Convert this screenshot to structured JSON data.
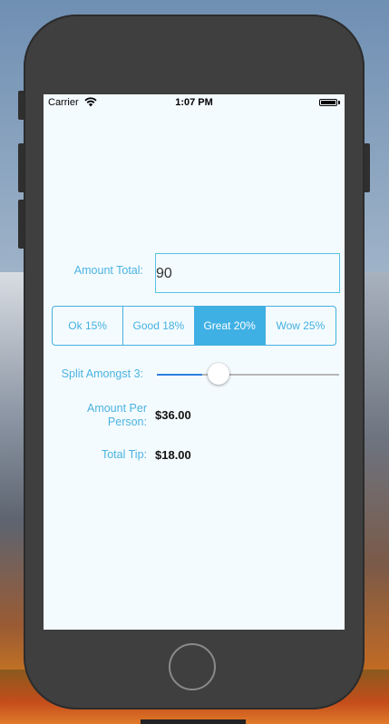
{
  "status_bar": {
    "carrier": "Carrier",
    "time": "1:07 PM"
  },
  "form": {
    "amount_label": "Amount Total:",
    "amount_value": "90",
    "tip_options": [
      "Ok 15%",
      "Good 18%",
      "Great 20%",
      "Wow 25%"
    ],
    "selected_tip_index": 2,
    "split_label": "Split Amongst 3:",
    "split_slider_fraction": 0.25,
    "per_person_label": "Amount Per Person:",
    "per_person_value": "$36.00",
    "total_tip_label": "Total Tip:",
    "total_tip_value": "$18.00"
  },
  "colors": {
    "accent": "#3fb0e4",
    "label": "#4bb3e0",
    "slider_fill": "#2f7fe0"
  },
  "icons": [
    "wifi-icon",
    "battery-icon"
  ]
}
